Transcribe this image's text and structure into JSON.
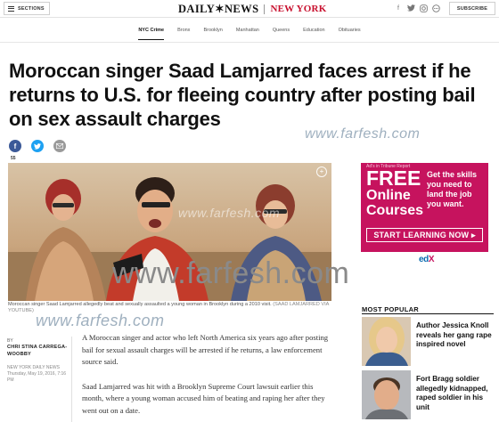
{
  "header": {
    "sections_label": "SECTIONS",
    "logo_main": "DAILY✶NEWS",
    "logo_city": "NEW YORK",
    "subscribe_label": "SUBSCRIBE",
    "social_icons": [
      "facebook-icon",
      "twitter-icon",
      "instagram-icon",
      "more-icon"
    ]
  },
  "nav": {
    "items": [
      {
        "label": "NYC Crime",
        "active": true
      },
      {
        "label": "Bronx"
      },
      {
        "label": "Brooklyn"
      },
      {
        "label": "Manhattan"
      },
      {
        "label": "Queens"
      },
      {
        "label": "Education"
      },
      {
        "label": "Obituaries"
      }
    ]
  },
  "article": {
    "headline": "Moroccan singer Saad Lamjarred faces arrest if he returns to U.S. for fleeing country after posting bail on sex assault charges",
    "share_count": "55",
    "image_caption": "Moroccan singer Saad Lamjarred allegedly beat and sexually assaulted a young woman in Brooklyn during a 2010 visit.",
    "image_credit": "(SAAD LAMJARRED VIA YOUTUBE)",
    "byline_label": "BY",
    "byline_name": "CHRI STINA CARREGA-WOOBBY",
    "publication": "NEW YORK DAILY NEWS",
    "dateline": "Thursday, May 19, 2016, 7:16 PM",
    "paragraphs": [
      "A Moroccan singer and actor who left North America six years ago after posting bail for sexual assault charges will be arrested if he returns, a law enforcement source said.",
      "Saad Lamjarred was hit with a Brooklyn Supreme Court lawsuit earlier this month, where a young woman accused him of beating and raping her after they went out on a date."
    ]
  },
  "watermarks": [
    "www.farfesh.com",
    "www.farfesh.com",
    "www.farfesh.com",
    "www.farfesh.com"
  ],
  "ad": {
    "tag": "Ad's in Tribune Report",
    "free": "FREE",
    "online": "Online",
    "courses": "Courses",
    "copy": "Get the skills you need to land the job you want.",
    "cta": "START LEARNING NOW ▸",
    "logo_prefix": "ed",
    "logo_suffix": "X",
    "colors": {
      "background": "#c6135e",
      "text": "#ffffff"
    }
  },
  "most_popular": {
    "title": "MOST POPULAR",
    "items": [
      {
        "headline": "Author Jessica Knoll reveals her gang rape inspired novel"
      },
      {
        "headline": "Fort Bragg soldier allegedly kidnapped, raped soldier in his unit"
      }
    ]
  }
}
